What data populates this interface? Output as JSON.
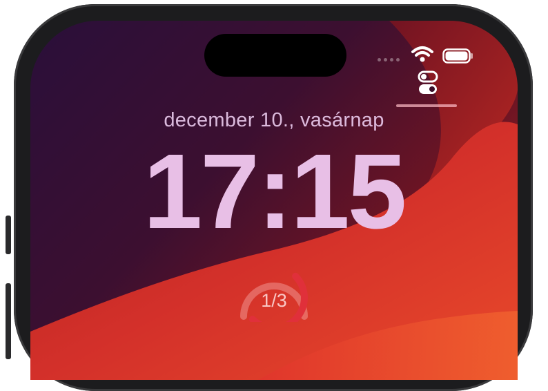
{
  "lock_screen": {
    "date": "december 10., vasárnap",
    "time": "17:15",
    "widget": {
      "label": "1/3",
      "progress": 0.333
    }
  },
  "status_bar": {
    "icons": [
      "signal-icon",
      "wifi-icon",
      "battery-icon",
      "controls-toggle-icon"
    ]
  },
  "colors": {
    "wallpaper_dark": "#2a0b2e",
    "wallpaper_red": "#d9302a",
    "time_text": "#e8bfe6",
    "widget_ring": "#e0303a"
  }
}
